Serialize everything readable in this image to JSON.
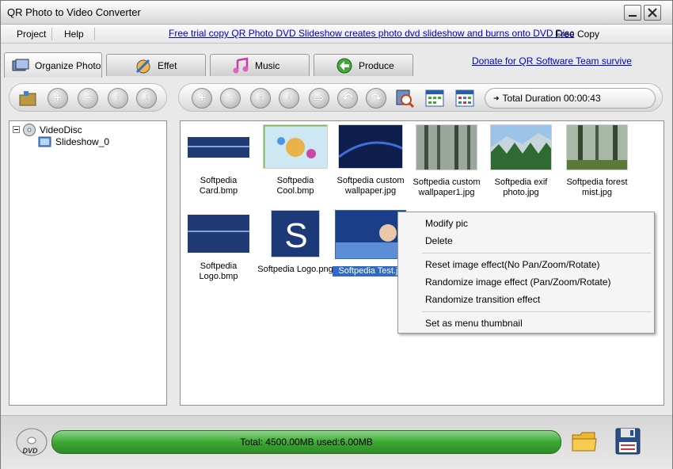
{
  "window": {
    "title": "QR Photo to Video Converter"
  },
  "menu": {
    "project": "Project",
    "help": "Help",
    "promo": "Free trial copy QR Photo DVD Slideshow creates photo dvd slideshow and burns onto DVD Disc",
    "free_copy": "Free Copy"
  },
  "tabs": [
    {
      "label": "Organize Photo",
      "active": true
    },
    {
      "label": "Effet",
      "active": false
    },
    {
      "label": "Music",
      "active": false
    },
    {
      "label": "Produce",
      "active": false
    }
  ],
  "donate": "Donate for QR Software Team survive",
  "toolbar": {
    "duration": "Total Duration 00:00:43"
  },
  "tree": {
    "root": "VideoDisc",
    "child": "Slideshow_0"
  },
  "photos": [
    {
      "label": "Softpedia Card.bmp",
      "selected": false
    },
    {
      "label": "Softpedia Cool.bmp",
      "selected": false
    },
    {
      "label": "Softpedia custom wallpaper.jpg",
      "selected": false
    },
    {
      "label": "Softpedia custom wallpaper1.jpg",
      "selected": false
    },
    {
      "label": "Softpedia exif photo.jpg",
      "selected": false
    },
    {
      "label": "Softpedia forest mist.jpg",
      "selected": false
    },
    {
      "label": "Softpedia Logo.bmp",
      "selected": false
    },
    {
      "label": "Softpedia Logo.png",
      "selected": false
    },
    {
      "label": "Softpedia Test.jp",
      "selected": true
    }
  ],
  "context_menu": {
    "items": [
      "Modify pic",
      "Delete",
      "Reset image effect(No Pan/Zoom/Rotate)",
      "Randomize image effect (Pan/Zoom/Rotate)",
      "Randomize transition effect",
      "Set as menu thumbnail"
    ]
  },
  "status": {
    "capacity": "Total: 4500.00MB used:6.00MB"
  },
  "colors": {
    "accent": "#316ac5",
    "link": "#0000cc",
    "progress": "#3da833"
  }
}
